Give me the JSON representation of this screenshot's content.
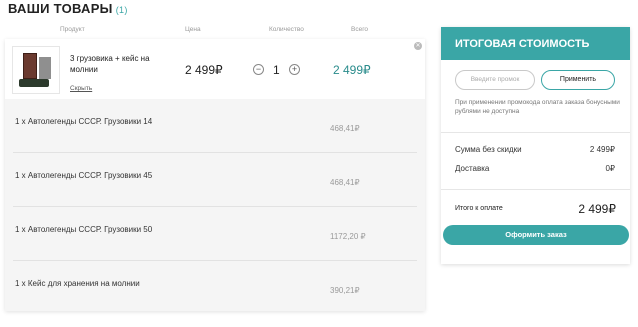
{
  "page": {
    "title": "ВАШИ ТОВАРЫ",
    "items_count": "(1)"
  },
  "columns": [
    "Продукт",
    "Цена",
    "Количество",
    "Всего"
  ],
  "product": {
    "name": "3 грузовика + кейс на молнии",
    "hide_label": "Скрыть",
    "price": "2 499₽",
    "qty_minus": "−",
    "quantity": "1",
    "qty_plus": "+",
    "total": "2 499₽",
    "close_icon": "close-icon"
  },
  "sub_items": [
    {
      "label": "1 x Автолегенды СССР. Грузовики 14",
      "value": "468,41₽"
    },
    {
      "label": "1 x Автолегенды СССР. Грузовики 45",
      "value": "468,41₽"
    },
    {
      "label": "1 x Автолегенды СССР. Грузовики 50",
      "value": "1172,20 ₽"
    },
    {
      "label": "1 x Кейс для хранения на молнии",
      "value": "390,21₽"
    }
  ],
  "summary": {
    "title": "ИТОГОВАЯ СТОИМОСТЬ",
    "promo_placeholder": "Введите промок",
    "apply_label": "Применить",
    "promo_note": "При применении промокода оплата заказа бонусными рублями не доступна",
    "subtotal_label": "Сумма без скидки",
    "subtotal_value": "2 499₽",
    "delivery_label": "Доставка",
    "delivery_value": "0₽",
    "to_pay_label": "Итого к оплате",
    "to_pay_value": "2 499₽",
    "checkout_label": "Оформить заказ"
  },
  "colors": {
    "accent": "#3aa6a6",
    "panel_bg": "#f5f5f5"
  }
}
